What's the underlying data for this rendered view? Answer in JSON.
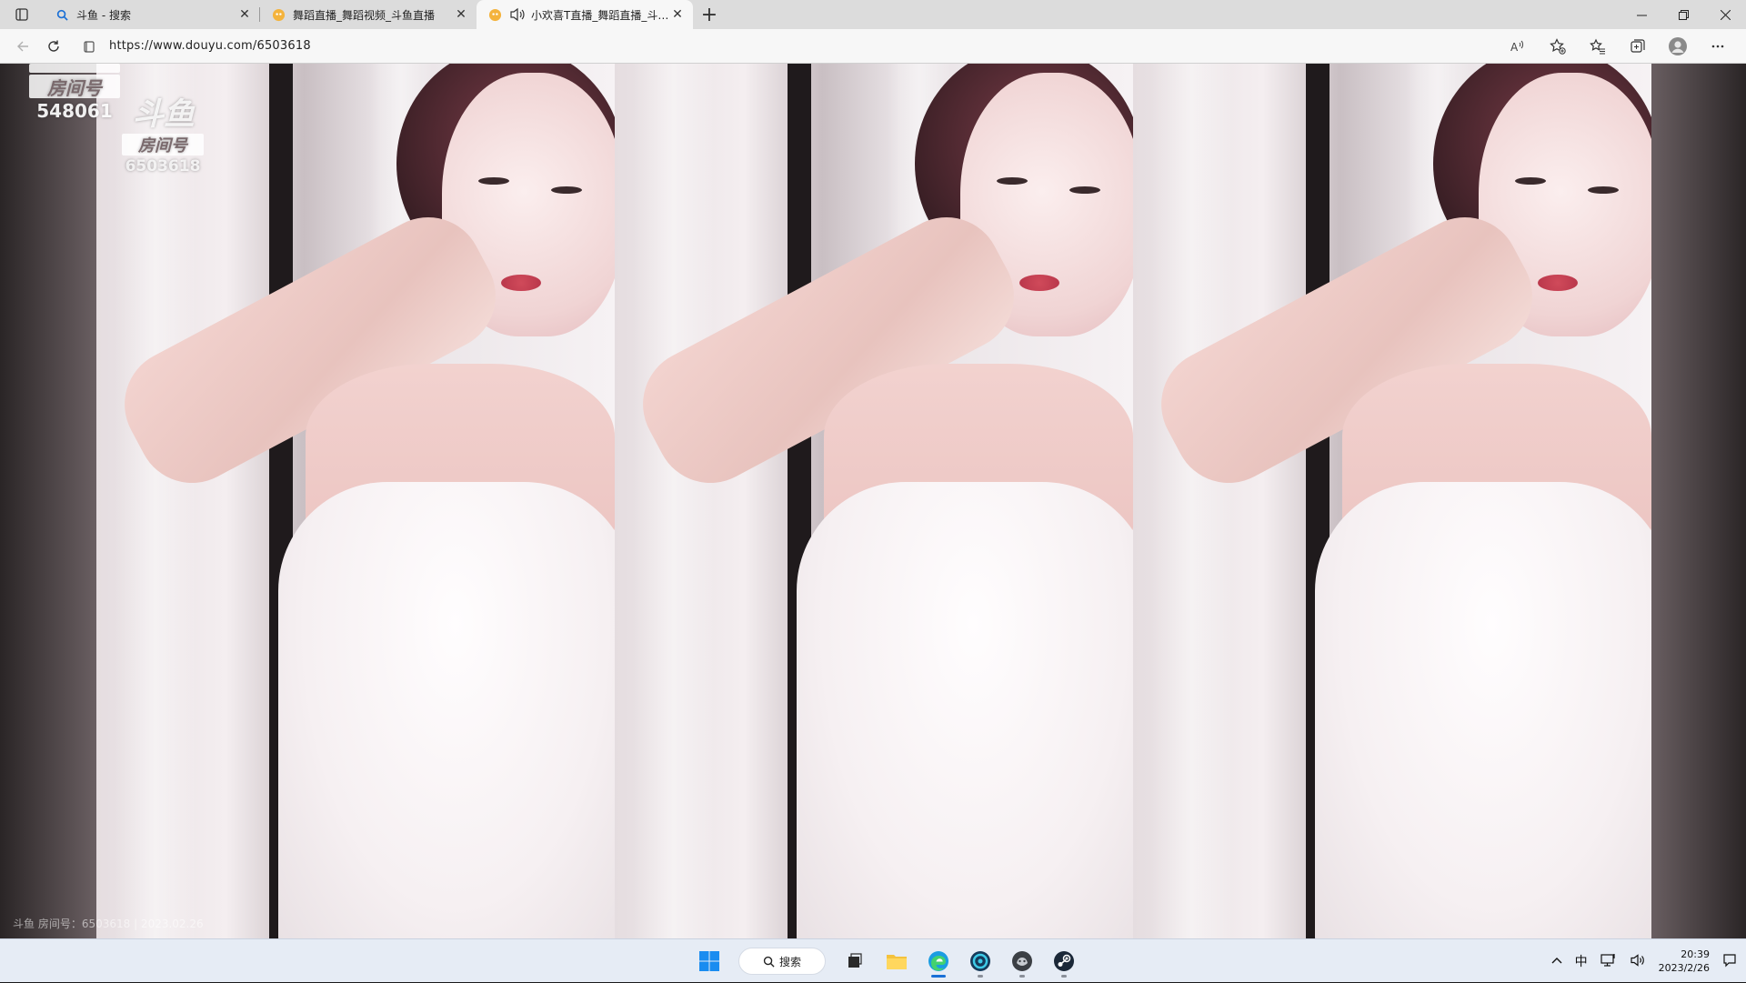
{
  "browser": {
    "tabs": [
      {
        "title": "斗鱼 - 搜索",
        "active": false
      },
      {
        "title": "舞蹈直播_舞蹈视频_斗鱼直播",
        "active": false
      },
      {
        "title": "小欢喜T直播_舞蹈直播_斗鱼直播",
        "active": true
      }
    ],
    "new_tab_label": "+",
    "url": "https://www.douyu.com/6503618"
  },
  "video": {
    "watermark_top": {
      "label": "房间号",
      "number": "548061"
    },
    "watermark_second": {
      "brand": "斗鱼",
      "label": "房间号",
      "number": "6503618"
    },
    "caption": "斗鱼 房间号：6503618 | 2023.02.26"
  },
  "taskbar": {
    "search_label": "搜索",
    "ime": "中",
    "time": "20:39",
    "date": "2023/2/26"
  },
  "colors": {
    "tab_strip": "#dcdcdc",
    "toolbar": "#f7f7f7",
    "taskbar": "#e6ecf5",
    "accent": "#1a6fd6"
  }
}
